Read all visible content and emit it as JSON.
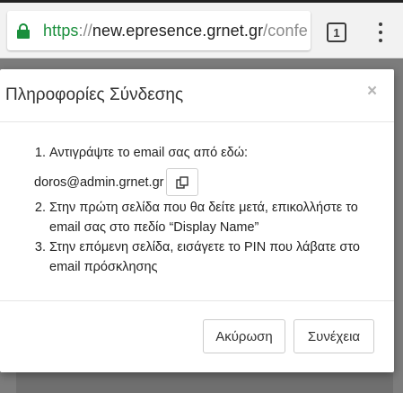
{
  "browser": {
    "url_scheme": "https",
    "url_separator": "://",
    "url_host": "new.epresence.grnet.gr",
    "url_path": "/confe",
    "tab_count": "1"
  },
  "dialog": {
    "title": "Πληροφορίες Σύνδεσης",
    "close_symbol": "×",
    "steps": [
      "Αντιγράψτε το email σας από εδώ:",
      "Στην πρώτη σελίδα που θα δείτε μετά, επικολλήστε το email σας στο πεδίο “Display Name”",
      "Στην επόμενη σελίδα, εισάγετε το PIN που λάβατε στο email πρόσκλησης"
    ],
    "email": "doros@admin.grnet.gr",
    "copy_icon": "copy-icon",
    "cancel_label": "Ακύρωση",
    "continue_label": "Συνέχεια"
  },
  "colors": {
    "secure_green": "#1a8f3c",
    "overlay": "#7a7a7a"
  }
}
